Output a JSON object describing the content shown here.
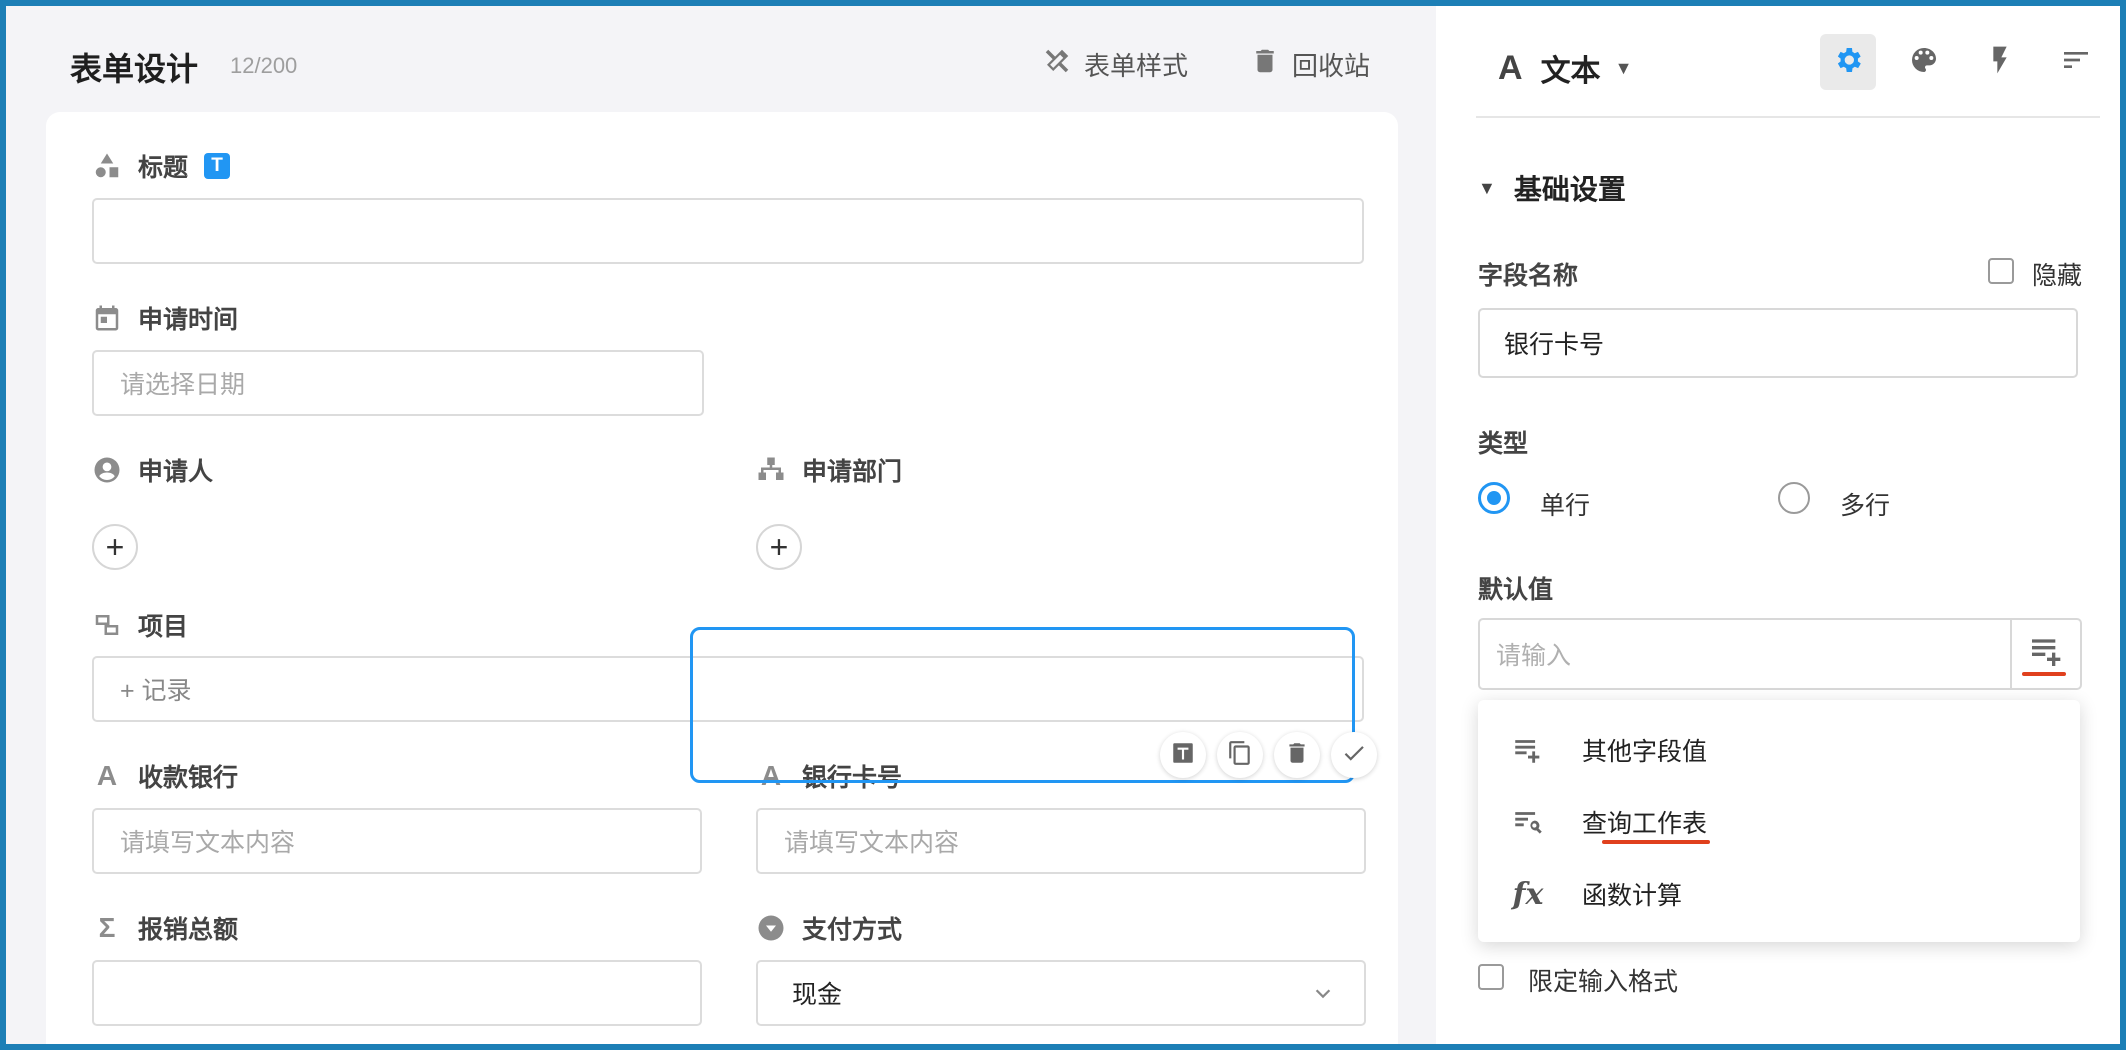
{
  "header": {
    "title": "表单设计",
    "count": "12/200",
    "style_label": "表单样式",
    "trash_label": "回收站"
  },
  "form": {
    "title_field": {
      "label": "标题",
      "badge": "T"
    },
    "apply_time": {
      "label": "申请时间",
      "placeholder": "请选择日期"
    },
    "applicant": {
      "label": "申请人",
      "add": "+"
    },
    "department": {
      "label": "申请部门",
      "add": "+"
    },
    "project": {
      "label": "项目",
      "placeholder": "+ 记录"
    },
    "bank": {
      "label": "收款银行",
      "placeholder": "请填写文本内容"
    },
    "card_no": {
      "label": "银行卡号",
      "placeholder": "请填写文本内容"
    },
    "total": {
      "label": "报销总额"
    },
    "payment": {
      "label": "支付方式",
      "value": "现金"
    }
  },
  "panel": {
    "field_type": "文本",
    "field_type_glyph": "A",
    "section": "基础设置",
    "field_name_label": "字段名称",
    "hide_label": "隐藏",
    "field_name_value": "银行卡号",
    "type_label": "类型",
    "type_options": [
      "单行",
      "多行"
    ],
    "type_selected": "单行",
    "default_label": "默认值",
    "default_placeholder": "请输入",
    "menu": [
      {
        "icon": "other-field-icon",
        "label": "其他字段值"
      },
      {
        "icon": "query-worksheet-icon",
        "label": "查询工作表"
      },
      {
        "icon": "function-icon",
        "label": "函数计算",
        "glyph": "fx"
      }
    ],
    "restrict_label": "限定输入格式"
  },
  "colors": {
    "accent": "#2196f3",
    "highlight": "#e0401d"
  }
}
